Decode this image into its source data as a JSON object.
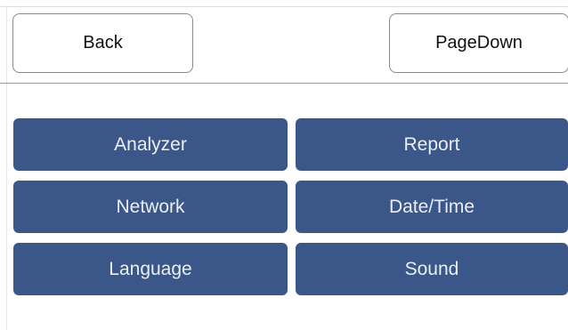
{
  "header": {
    "back_label": "Back",
    "pagedown_label": "PageDown"
  },
  "menu": {
    "items": [
      {
        "label": "Analyzer"
      },
      {
        "label": "Report"
      },
      {
        "label": "Network"
      },
      {
        "label": "Date/Time"
      },
      {
        "label": "Language"
      },
      {
        "label": "Sound"
      }
    ]
  },
  "colors": {
    "button_fill": "#3b5689",
    "button_text": "#e9eef7",
    "divider": "#9a9a9a"
  }
}
